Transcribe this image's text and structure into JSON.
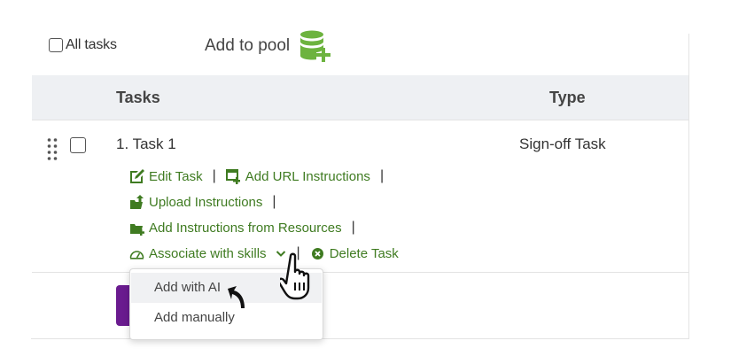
{
  "toolbar": {
    "all_tasks_label": "All tasks",
    "add_to_pool_label": "Add to pool"
  },
  "table": {
    "headers": {
      "tasks": "Tasks",
      "type": "Type"
    },
    "rows": [
      {
        "name": "1. Task 1",
        "type": "Sign-off Task",
        "actions": {
          "edit_task": "Edit Task",
          "add_url_instructions": "Add URL Instructions",
          "upload_instructions": "Upload Instructions",
          "add_instructions_from_resources": "Add Instructions from Resources",
          "associate_with_skills": "Associate with skills",
          "delete_task": "Delete Task"
        }
      }
    ]
  },
  "dropdown": {
    "items": [
      {
        "label": "Add with AI",
        "state": "hovered"
      },
      {
        "label": "Add manually",
        "state": "normal"
      }
    ]
  },
  "colors": {
    "action_green": "#3f7b21",
    "header_bg": "#eef0f3",
    "primary_purple": "#6a1b8f",
    "pool_icon_green": "#6db33f"
  },
  "icons": {
    "pool": "database-plus-icon",
    "edit": "edit-icon",
    "url": "add-url-icon",
    "upload": "upload-folder-icon",
    "resources": "resources-folder-icon",
    "skills": "gauge-icon",
    "delete": "delete-circle-icon",
    "drag": "drag-handle-icon"
  }
}
